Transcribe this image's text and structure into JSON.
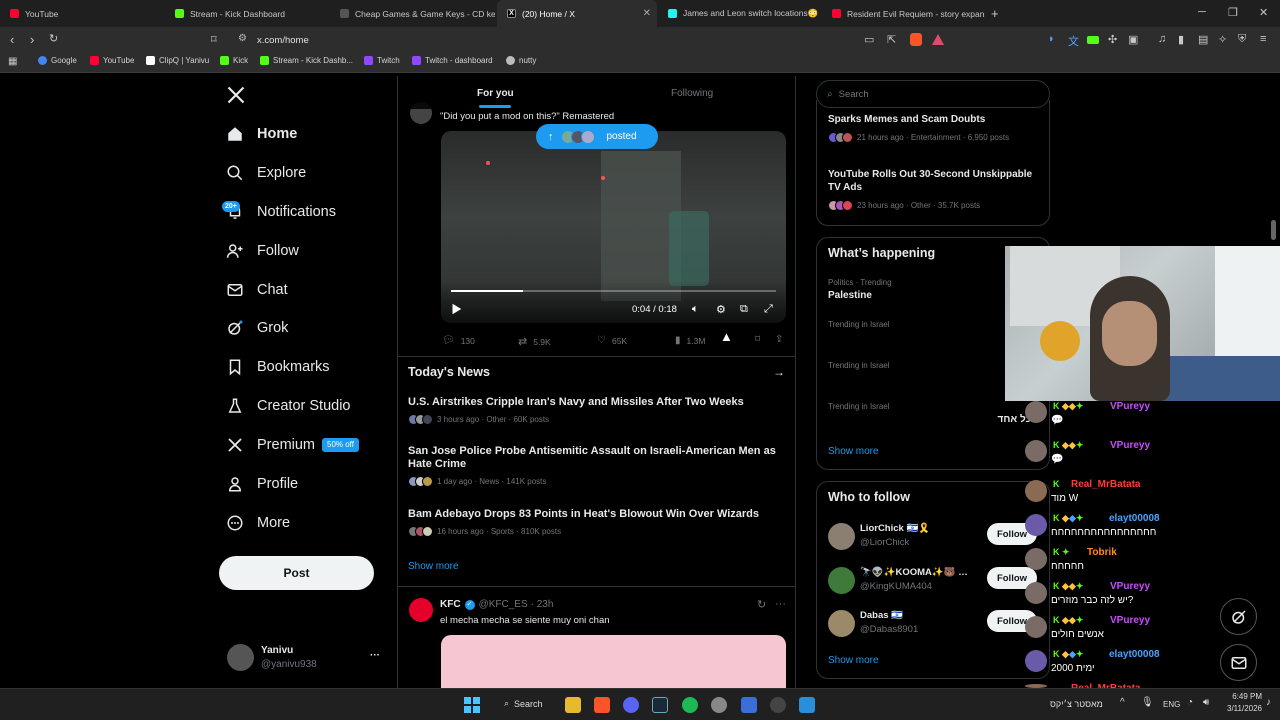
{
  "browser": {
    "tabs": [
      {
        "title": "YouTube",
        "color": "#ff0033"
      },
      {
        "title": "Stream - Kick Dashboard",
        "color": "#53fc18"
      },
      {
        "title": "Cheap Games & Game Keys - CD key",
        "color": "#888888"
      },
      {
        "title": "(20) Home / X",
        "color": "#ffffff"
      },
      {
        "title": "James and Leon switch locations😳",
        "color": "#25f4ee"
      },
      {
        "title": "Resident Evil Requiem - story expans",
        "color": "#ff0033"
      }
    ],
    "new_tab": "+",
    "url": "x.com/home",
    "bookmarks": [
      {
        "label": "Google",
        "color": "#4285f4"
      },
      {
        "label": "YouTube",
        "color": "#ff0033"
      },
      {
        "label": "ClipQ | Yanivu",
        "color": "#ffffff"
      },
      {
        "label": "Kick",
        "color": "#53fc18"
      },
      {
        "label": "Stream - Kick Dashb...",
        "color": "#53fc18"
      },
      {
        "label": "Twitch",
        "color": "#9146ff"
      },
      {
        "label": "Twitch - dashboard",
        "color": "#9146ff"
      },
      {
        "label": "nutty",
        "color": "#bbbbbb"
      }
    ]
  },
  "nav": {
    "items": [
      {
        "label": "Home",
        "icon": "home-icon"
      },
      {
        "label": "Explore",
        "icon": "search-icon"
      },
      {
        "label": "Notifications",
        "icon": "bell-icon",
        "badge": "20+"
      },
      {
        "label": "Follow",
        "icon": "person-add-icon"
      },
      {
        "label": "Chat",
        "icon": "envelope-icon"
      },
      {
        "label": "Grok",
        "icon": "grok-icon"
      },
      {
        "label": "Bookmarks",
        "icon": "bookmark-icon"
      },
      {
        "label": "Creator Studio",
        "icon": "flask-icon"
      },
      {
        "label": "Premium",
        "icon": "x-icon",
        "badge": "50% off"
      },
      {
        "label": "Profile",
        "icon": "person-icon"
      },
      {
        "label": "More",
        "icon": "more-circle-icon"
      }
    ],
    "post_button": "Post",
    "account": {
      "name": "Yanivu",
      "handle": "@yanivu938",
      "more": "···"
    }
  },
  "feed": {
    "tabs": [
      "For you",
      "Following"
    ],
    "tweet1": {
      "text": "\"Did you put a mod on this?\" Remastered",
      "posted_pill": "posted",
      "video_time": "0:04 / 0:18",
      "video_progress": 0.22,
      "stats": {
        "replies": "130",
        "reposts": "5.9K",
        "likes": "65K",
        "views": "1.3M"
      }
    },
    "news": {
      "heading": "Today's News",
      "items": [
        {
          "title": "U.S. Airstrikes Cripple Iran's Navy and Missiles After Two Weeks",
          "meta": "3 hours ago · Other · 60K posts"
        },
        {
          "title": "San Jose Police Probe Antisemitic Assault on Israeli-American Men as Hate Crime",
          "meta": "1 day ago · News · 141K posts"
        },
        {
          "title": "Bam Adebayo Drops 83 Points in Heat's Blowout Win Over Wizards",
          "meta": "16 hours ago · Sports · 810K posts"
        }
      ],
      "show_more": "Show more"
    },
    "tweet2": {
      "name": "KFC",
      "handle": "@KFC_ES",
      "time": "· 23h",
      "text": "el mecha mecha se siente muy oni chan"
    }
  },
  "right": {
    "search_placeholder": "Search",
    "top_news": [
      {
        "title": "Sparks Memes and Scam Doubts",
        "meta": "21 hours ago · Entertainment · 6,950 posts"
      },
      {
        "title": "YouTube Rolls Out 30-Second Unskippable TV Ads",
        "meta": "23 hours ago · Other · 35.7K posts"
      }
    ],
    "happening": {
      "heading": "What’s happening",
      "items": [
        {
          "context": "Politics · Trending",
          "title": "Palestine"
        },
        {
          "context": "Trending in Israel",
          "title": ""
        },
        {
          "context": "Trending in Israel",
          "title": ""
        },
        {
          "context": "Trending in Israel",
          "title": "כל אחד"
        }
      ],
      "show_more": "Show more"
    },
    "who_to_follow": {
      "heading": "Who to follow",
      "users": [
        {
          "name": "LiorChick 🇮🇱🎗️",
          "handle": "@LiorChick"
        },
        {
          "name": "🔭👽✨KOOMA✨🐻 …",
          "handle": "@KingKUMA404"
        },
        {
          "name": "Dabas 🇮🇱",
          "handle": "@Dabas8901"
        }
      ],
      "follow_label": "Follow",
      "show_more": "Show more"
    }
  },
  "chat": [
    {
      "name": "VPureyy",
      "msg": "💬",
      "color": "#c94cff"
    },
    {
      "name": "VPureyy",
      "msg": "💬",
      "color": "#c94cff"
    },
    {
      "name": "Real_MrBatata",
      "msg": "מוד W",
      "color": "#ff3b3b"
    },
    {
      "name": "elayt00008",
      "msg": "חחחחחחחחחחחחחחחח",
      "color": "#4aa3ff"
    },
    {
      "name": "Tobrik",
      "msg": "חחחחח",
      "color": "#ff8c1a"
    },
    {
      "name": "VPureyy",
      "msg": "יש לזה כבר מוזרים?",
      "color": "#c94cff"
    },
    {
      "name": "VPureyy",
      "msg": "אנשים חולים",
      "color": "#c94cff"
    },
    {
      "name": "elayt00008",
      "msg": "ימית 2000",
      "color": "#4aa3ff"
    },
    {
      "name": "Real_MrBatata",
      "msg": "",
      "color": "#ff3b3b"
    }
  ],
  "taskbar": {
    "search": "Search",
    "lang": "ENG",
    "time": "6:49 PM",
    "date": "3/11/2026",
    "tray_text": "מאסטר צ׳יקס"
  }
}
